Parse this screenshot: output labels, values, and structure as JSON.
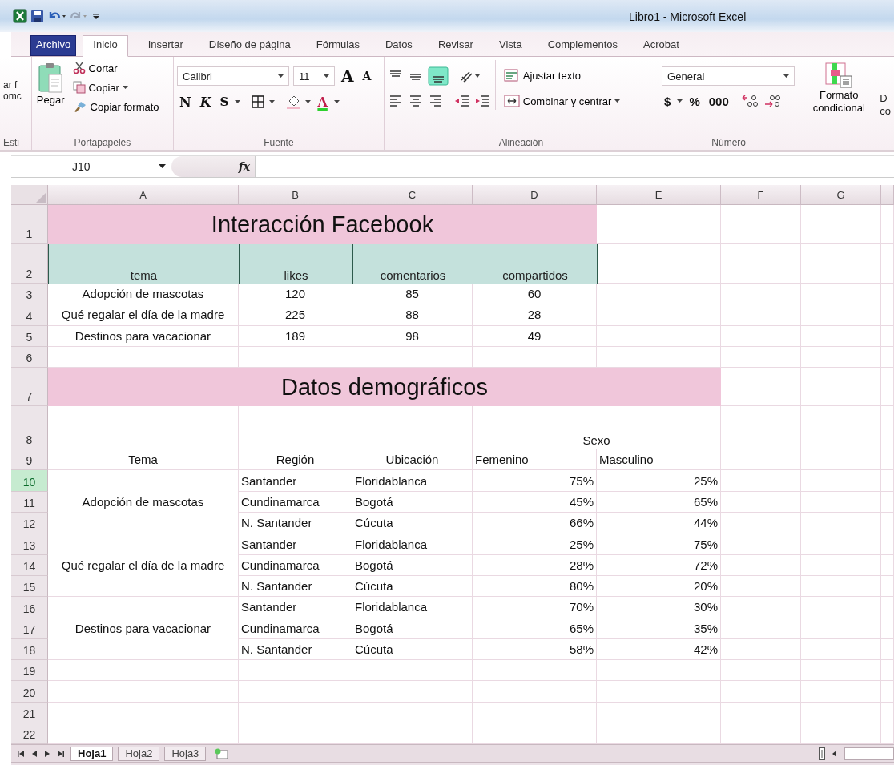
{
  "window": {
    "title": "Libro1  -  Microsoft Excel"
  },
  "ribbon_tabs": [
    {
      "label": "Archivo",
      "kind": "file",
      "selected": false
    },
    {
      "label": "Inicio",
      "kind": "tab",
      "selected": true
    },
    {
      "label": "Insertar",
      "kind": "tab",
      "selected": false
    },
    {
      "label": "Díseño de página",
      "kind": "tab",
      "selected": false
    },
    {
      "label": "Fórmulas",
      "kind": "tab",
      "selected": false
    },
    {
      "label": "Datos",
      "kind": "tab",
      "selected": false
    },
    {
      "label": "Revisar",
      "kind": "tab",
      "selected": false
    },
    {
      "label": "Vista",
      "kind": "tab",
      "selected": false
    },
    {
      "label": "Complementos",
      "kind": "tab",
      "selected": false
    },
    {
      "label": "Acrobat",
      "kind": "tab",
      "selected": false
    }
  ],
  "ribbon": {
    "cut_left": {
      "line_1": "ar f",
      "line_2": "omc",
      "group": "Esti"
    },
    "clipboard": {
      "paste": "Pegar",
      "cut": "Cortar",
      "copy": "Copiar",
      "format_painter": "Copiar formato",
      "label": "Portapapeles"
    },
    "font": {
      "font_name": "Calibri",
      "font_size": "11",
      "grow": "A",
      "shrink": "A",
      "bold": "N",
      "italic": "K",
      "underline": "S",
      "font_color": "A",
      "label": "Fuente"
    },
    "alignment": {
      "wrap_text": "Ajustar texto",
      "merge": "Combinar y centrar",
      "label": "Alineación"
    },
    "number": {
      "format": "General",
      "currency": "$",
      "percent": "%",
      "thousands": "000",
      "label": "Número"
    },
    "styles": {
      "conditional_line_1": "Formato",
      "conditional_line_2": "condicional",
      "cut_line_1": "D",
      "cut_line_2": "co"
    }
  },
  "formula_bar": {
    "name_box": "J10",
    "fx": "fx"
  },
  "sheet": {
    "columns": [
      {
        "label": "A",
        "selected": false
      },
      {
        "label": "B",
        "selected": false
      },
      {
        "label": "C",
        "selected": false
      },
      {
        "label": "D",
        "selected": false
      },
      {
        "label": "E",
        "selected": false
      },
      {
        "label": "F",
        "selected": false
      },
      {
        "label": "G",
        "selected": false
      }
    ],
    "rows": [
      {
        "label": "1",
        "selected": false
      },
      {
        "label": "2",
        "selected": false
      },
      {
        "label": "3",
        "selected": false
      },
      {
        "label": "4",
        "selected": false
      },
      {
        "label": "5",
        "selected": false
      },
      {
        "label": "6",
        "selected": false
      },
      {
        "label": "7",
        "selected": false
      },
      {
        "label": "8",
        "selected": false
      },
      {
        "label": "9",
        "selected": false
      },
      {
        "label": "10",
        "selected": true
      },
      {
        "label": "11",
        "selected": false
      },
      {
        "label": "12",
        "selected": false
      },
      {
        "label": "13",
        "selected": false
      },
      {
        "label": "14",
        "selected": false
      },
      {
        "label": "15",
        "selected": false
      },
      {
        "label": "16",
        "selected": false
      },
      {
        "label": "17",
        "selected": false
      },
      {
        "label": "18",
        "selected": false
      },
      {
        "label": "19",
        "selected": false
      },
      {
        "label": "20",
        "selected": false
      },
      {
        "label": "21",
        "selected": false
      },
      {
        "label": "22",
        "selected": false
      }
    ],
    "title_1": "Interacción Facebook",
    "table_1": {
      "columns": [
        "tema",
        "likes",
        "comentarios",
        "compartidos"
      ],
      "rows": [
        [
          "Adopción de mascotas",
          "120",
          "85",
          "60"
        ],
        [
          "Qué regalar el día de la madre",
          "225",
          "88",
          "28"
        ],
        [
          "Destinos para vacacionar",
          "189",
          "98",
          "49"
        ]
      ]
    },
    "title_2": "Datos demográficos",
    "table_2": {
      "group_header": "Sexo",
      "columns": [
        "Tema",
        "Región",
        "Ubicación",
        "Femenino",
        "Masculino"
      ],
      "groups": [
        {
          "topic": "Adopción de mascotas",
          "rows": [
            [
              "Santander",
              "Floridablanca",
              "75%",
              "25%"
            ],
            [
              "Cundinamarca",
              "Bogotá",
              "45%",
              "65%"
            ],
            [
              "N. Santander",
              "Cúcuta",
              "66%",
              "44%"
            ]
          ]
        },
        {
          "topic": "Qué regalar el día de la madre",
          "rows": [
            [
              "Santander",
              "Floridablanca",
              "25%",
              "75%"
            ],
            [
              "Cundinamarca",
              "Bogotá",
              "28%",
              "72%"
            ],
            [
              "N. Santander",
              "Cúcuta",
              "80%",
              "20%"
            ]
          ]
        },
        {
          "topic": "Destinos para vacacionar",
          "rows": [
            [
              "Santander",
              "Floridablanca",
              "70%",
              "30%"
            ],
            [
              "Cundinamarca",
              "Bogotá",
              "65%",
              "35%"
            ],
            [
              "N. Santander",
              "Cúcuta",
              "58%",
              "42%"
            ]
          ]
        }
      ]
    }
  },
  "sheet_tabs": [
    {
      "label": "Hoja1",
      "selected": true
    },
    {
      "label": "Hoja2",
      "selected": false
    },
    {
      "label": "Hoja3",
      "selected": false
    }
  ]
}
